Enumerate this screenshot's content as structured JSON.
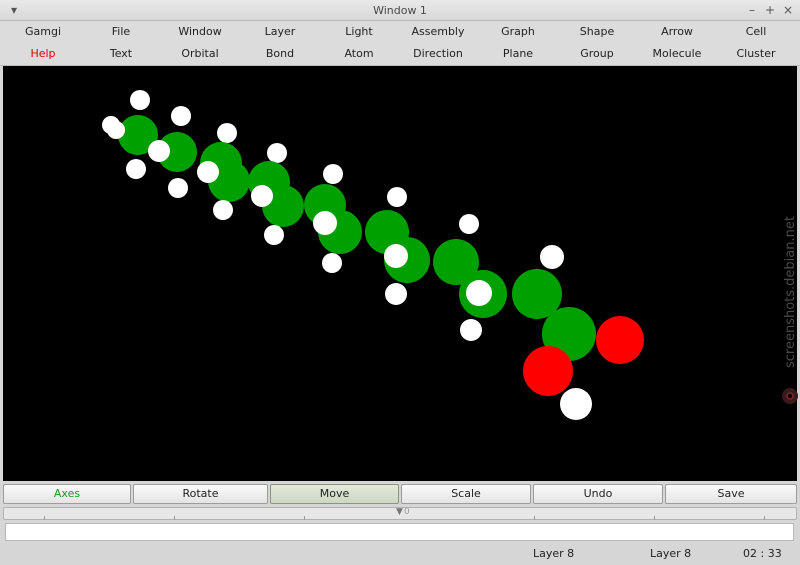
{
  "window": {
    "title": "Window 1",
    "menu_button": "▾",
    "minimize": "–",
    "maximize": "+",
    "close": "×"
  },
  "menu": {
    "row1": [
      "Gamgi",
      "File",
      "Window",
      "Layer",
      "Light",
      "Assembly",
      "Graph",
      "Shape",
      "Arrow",
      "Cell"
    ],
    "row2": [
      "Help",
      "Text",
      "Orbital",
      "Bond",
      "Atom",
      "Direction",
      "Plane",
      "Group",
      "Molecule",
      "Cluster"
    ]
  },
  "toolbar": {
    "axes": "Axes",
    "rotate": "Rotate",
    "move": "Move",
    "scale": "Scale",
    "undo": "Undo",
    "save": "Save"
  },
  "slider": {
    "value": "0"
  },
  "command": {
    "value": ""
  },
  "status": {
    "layer_left": "Layer 8",
    "layer_right": "Layer 8",
    "time": "02 : 33"
  },
  "watermark": {
    "text": "screenshots.debian.net"
  },
  "colors": {
    "carbon": "#00a000",
    "hydrogen": "#ffffff",
    "oxygen": "#ff0000",
    "background": "#000000",
    "help_text": "#e00000",
    "axes_text": "#1a9a1a"
  },
  "icons": {
    "window_menu": "chevron-down-icon",
    "minimize": "minimize-icon",
    "maximize": "maximize-icon",
    "close": "close-icon",
    "slider_handle": "slider-handle-icon",
    "watermark": "debian-swirl-icon"
  }
}
